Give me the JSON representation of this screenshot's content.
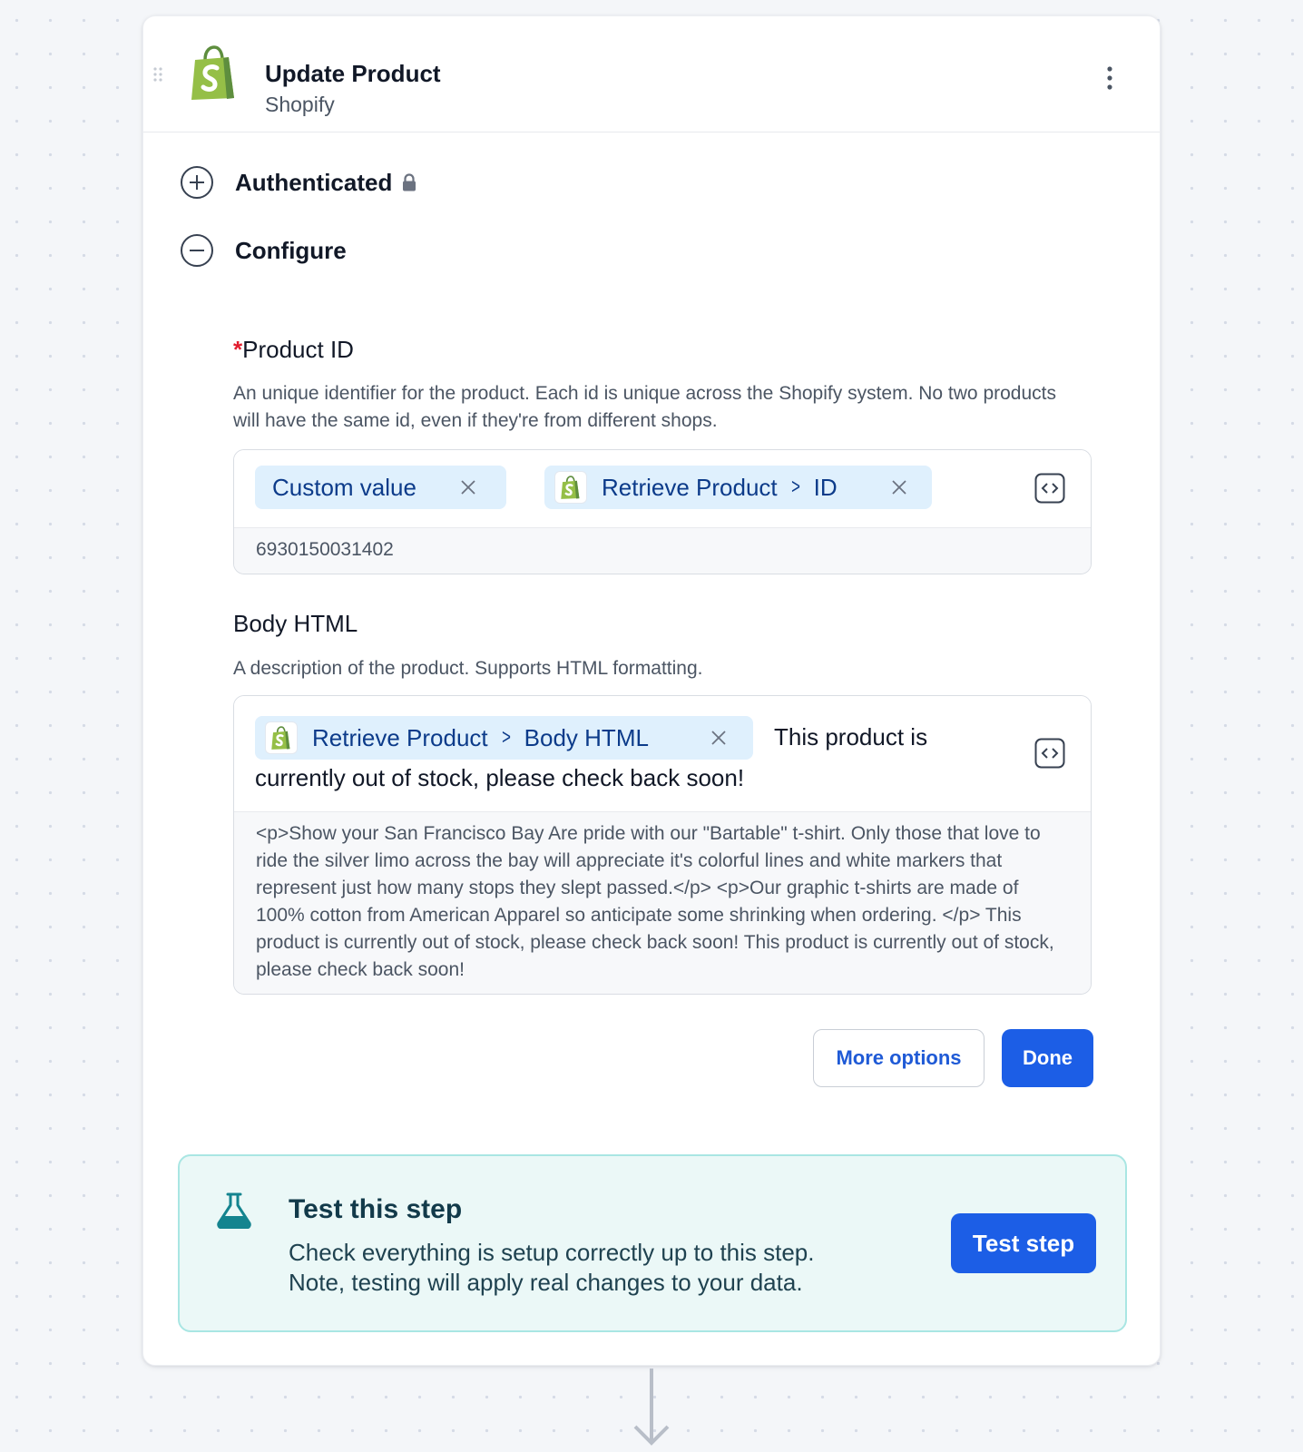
{
  "step": {
    "title": "Update Product",
    "app_name": "Shopify"
  },
  "sections": {
    "authenticated_label": "Authenticated",
    "configure_label": "Configure"
  },
  "product_id": {
    "required_marker": "*",
    "label": "Product ID",
    "description": "An unique identifier for the product. Each id is unique across the Shopify system. No two products will have the same id, even if they're from different shops.",
    "pill_custom": "Custom value",
    "pill_ref_source": "Retrieve Product",
    "pill_ref_field": "ID",
    "preview": "6930150031402"
  },
  "body_html": {
    "label": "Body HTML",
    "description": "A description of the product. Supports HTML formatting.",
    "pill_ref_source": "Retrieve Product",
    "pill_ref_field": "Body HTML",
    "text_after_pill": "This product is",
    "text_line2": "currently out of stock, please check back soon!",
    "preview": "<p>Show your San Francisco Bay Are pride with our \"Bartable\" t-shirt. Only those that love to ride the silver limo across the bay will appreciate it's colorful lines and white markers that represent just how many stops they slept passed.</p> <p>Our graphic t-shirts are made of 100% cotton from American Apparel so anticipate some shrinking when ordering.  </p> This product is currently out of stock, please check back soon! This product is currently out of stock, please check back soon!"
  },
  "actions": {
    "more_options": "More options",
    "done": "Done"
  },
  "test_panel": {
    "title": "Test this step",
    "line1": "Check everything is setup correctly up to this step.",
    "line2": "Note, testing will apply real changes to your data.",
    "button": "Test step"
  },
  "icons": {
    "drag": "drag-handle-icon",
    "logo": "shopify-bag-icon",
    "menu": "kebab-menu-icon",
    "expand": "plus-circle-icon",
    "collapse": "minus-circle-icon",
    "lock": "lock-icon",
    "remove": "close-icon",
    "code": "code-toggle-icon",
    "flask": "flask-icon",
    "arrow": "arrow-down-icon"
  },
  "colors": {
    "accent": "#1c5ee6",
    "pill_bg": "#dff0fd",
    "pill_text": "#0c3b8a",
    "shopify_green": "#95bf47",
    "required": "#e11d2e",
    "test_bg": "#ebf8f7",
    "test_border": "#a9e6e3",
    "flask": "#14848f"
  }
}
